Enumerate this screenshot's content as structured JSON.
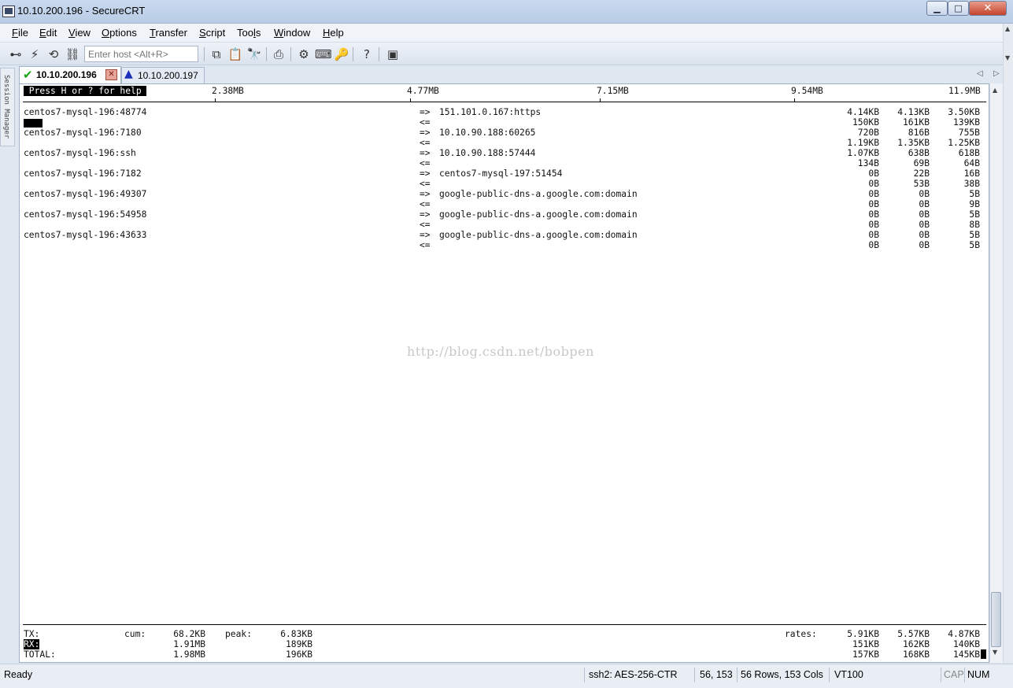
{
  "window": {
    "title": "10.10.200.196 - SecureCRT",
    "minimize": "▁",
    "maximize": "□",
    "close": "✕"
  },
  "menu": [
    "File",
    "Edit",
    "View",
    "Options",
    "Transfer",
    "Script",
    "Tools",
    "Window",
    "Help"
  ],
  "menu_underline": [
    "F",
    "E",
    "V",
    "O",
    "T",
    "S",
    "l",
    "W",
    "H"
  ],
  "toolbar": {
    "host_placeholder": "Enter host <Alt+R>",
    "icons": [
      "connect-icon",
      "quick-connect-icon",
      "reconnect-icon",
      "disconnect-icon",
      "copy-icon",
      "paste-icon",
      "find-icon",
      "print-icon",
      "settings-icon",
      "keymap-icon",
      "sftp-icon",
      "help-icon",
      "session-icon"
    ]
  },
  "sidebar": {
    "session_manager": "Session Manager"
  },
  "tabs": [
    {
      "label": "10.10.200.196",
      "status": "connected",
      "active": true
    },
    {
      "label": "10.10.200.197",
      "status": "warning",
      "active": false
    }
  ],
  "terminal": {
    "help_text": " Press H or ? for help ",
    "scale": [
      "2.38MB",
      "4.77MB",
      "7.15MB",
      "9.54MB",
      "11.9MB"
    ],
    "connections": [
      {
        "src": "centos7-mysql-196:48774",
        "dst": "151.101.0.167:https",
        "out": [
          "4.14KB",
          "4.13KB",
          "3.50KB"
        ],
        "in": [
          "150KB",
          "161KB",
          "139KB"
        ]
      },
      {
        "src": "centos7-mysql-196:7180",
        "dst": "10.10.90.188:60265",
        "out": [
          "720B",
          "816B",
          "755B"
        ],
        "in": [
          "1.19KB",
          "1.35KB",
          "1.25KB"
        ]
      },
      {
        "src": "centos7-mysql-196:ssh",
        "dst": "10.10.90.188:57444",
        "out": [
          "1.07KB",
          "638B",
          "618B"
        ],
        "in": [
          "134B",
          "69B",
          "64B"
        ]
      },
      {
        "src": "centos7-mysql-196:7182",
        "dst": "centos7-mysql-197:51454",
        "out": [
          "0B",
          "22B",
          "16B"
        ],
        "in": [
          "0B",
          "53B",
          "38B"
        ]
      },
      {
        "src": "centos7-mysql-196:49307",
        "dst": "google-public-dns-a.google.com:domain",
        "out": [
          "0B",
          "0B",
          "5B"
        ],
        "in": [
          "0B",
          "0B",
          "9B"
        ]
      },
      {
        "src": "centos7-mysql-196:54958",
        "dst": "google-public-dns-a.google.com:domain",
        "out": [
          "0B",
          "0B",
          "5B"
        ],
        "in": [
          "0B",
          "0B",
          "8B"
        ]
      },
      {
        "src": "centos7-mysql-196:43633",
        "dst": "google-public-dns-a.google.com:domain",
        "out": [
          "0B",
          "0B",
          "5B"
        ],
        "in": [
          "0B",
          "0B",
          "5B"
        ]
      }
    ],
    "arrow_out": "=>",
    "arrow_in": "<=",
    "watermark": "http://blog.csdn.net/bobpen",
    "footer": {
      "tx_label": "TX:",
      "rx_label": "RX:",
      "total_label": "TOTAL:",
      "cum_label": "cum:",
      "peak_label": "peak:",
      "rates_label": "rates:",
      "tx_cum": "68.2KB",
      "tx_peak": "6.83KB",
      "tx_rates": [
        "5.91KB",
        "5.57KB",
        "4.87KB"
      ],
      "rx_cum": "1.91MB",
      "rx_peak": "189KB",
      "rx_rates": [
        "151KB",
        "162KB",
        "140KB"
      ],
      "total_cum": "1.98MB",
      "total_peak": "196KB",
      "total_rates": [
        "157KB",
        "168KB",
        "145KB"
      ]
    }
  },
  "status": {
    "ready": "Ready",
    "protocol": "ssh2: AES-256-CTR",
    "cursor": "56, 153",
    "size": "56 Rows, 153 Cols",
    "emulation": "VT100",
    "cap": "CAP",
    "num": "NUM"
  }
}
